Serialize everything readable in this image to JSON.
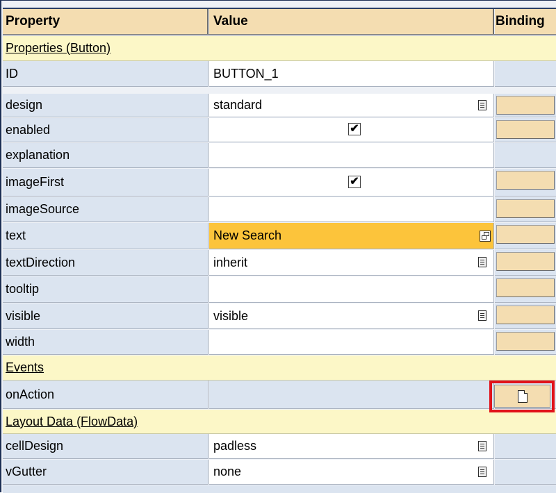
{
  "header": {
    "property": "Property",
    "value": "Value",
    "binding": "Binding"
  },
  "sections": {
    "properties": "Properties (Button)",
    "events": "Events",
    "layout": "Layout Data (FlowData)"
  },
  "rows": [
    {
      "name": "ID",
      "value": "BUTTON_1"
    },
    {
      "name": "design",
      "value": "standard"
    },
    {
      "name": "enabled",
      "value": ""
    },
    {
      "name": "explanation",
      "value": ""
    },
    {
      "name": "imageFirst",
      "value": ""
    },
    {
      "name": "imageSource",
      "value": ""
    },
    {
      "name": "text",
      "value": "New Search"
    },
    {
      "name": "textDirection",
      "value": "inherit"
    },
    {
      "name": "tooltip",
      "value": ""
    },
    {
      "name": "visible",
      "value": "visible"
    },
    {
      "name": "width",
      "value": ""
    }
  ],
  "events": [
    {
      "name": "onAction"
    }
  ],
  "layout_rows": [
    {
      "name": "cellDesign",
      "value": "padless"
    },
    {
      "name": "vGutter",
      "value": "none"
    }
  ],
  "checkbox_glyph": "✔",
  "colors": {
    "header_bg": "#f4ddb1",
    "section_bg": "#fcf7c7",
    "label_bg": "#dbe4f0",
    "highlight_bg": "#fcc43b",
    "event_highlight": "#e1121a"
  },
  "icons": {
    "dropdown": "dropdown-icon",
    "checkbox": "checkbox-checked-icon",
    "popup": "popup-window-icon",
    "event_handler": "document-icon"
  }
}
